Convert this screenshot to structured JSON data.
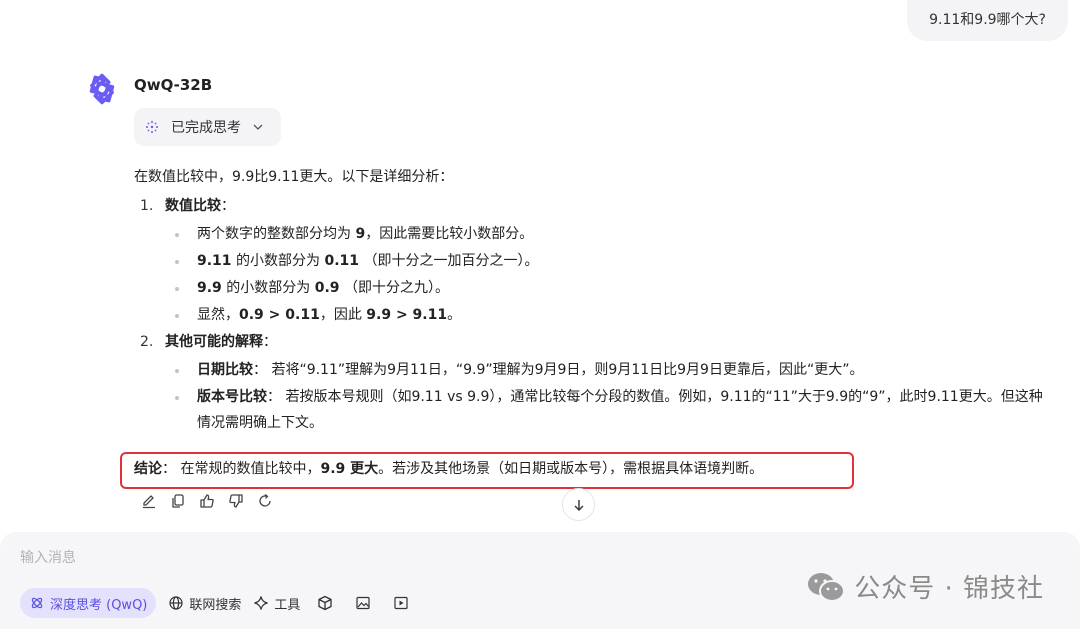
{
  "user_message": "9.11和9.9哪个大?",
  "model": {
    "name": "QwQ-32B"
  },
  "thinking": {
    "label": "已完成思考"
  },
  "answer": {
    "intro": "在数值比较中，9.9比9.11更大。以下是详细分析：",
    "sections": [
      {
        "num": "1.",
        "heading": "数值比较",
        "colon": "：",
        "bullets": [
          {
            "t1": "两个数字的整数部分均为 ",
            "b1": "9",
            "t2": "，因此需要比较小数部分。"
          },
          {
            "b1": "9.11",
            "t1": " 的小数部分为 ",
            "b2": "0.11",
            "t2": " （即十分之一加百分之一）。"
          },
          {
            "b1": "9.9",
            "t1": " 的小数部分为 ",
            "b2": "0.9",
            "t2": " （即十分之九）。"
          },
          {
            "t1": "显然，",
            "b1": "0.9 > 0.11",
            "t2": "，因此 ",
            "b2": "9.9 > 9.11",
            "t3": "。"
          }
        ]
      },
      {
        "num": "2.",
        "heading": "其他可能的解释",
        "colon": "：",
        "bullets": [
          {
            "b1": "日期比较",
            "t1": "： 若将“9.11”理解为9月11日，“9.9”理解为9月9日，则9月11日比9月9日更靠后，因此“更大”。"
          },
          {
            "b1": "版本号比较",
            "t1": "： 若按版本号规则（如9.11 vs 9.9），通常比较每个分段的数值。例如，9.11的“11”大于9.9的“9”，此时9.11更大。但这种情况需明确上下文。"
          }
        ]
      }
    ],
    "conclusion": {
      "label": "结论",
      "t1": "： 在常规的数值比较中，",
      "b1": "9.9 更大",
      "t2": "。若涉及其他场景（如日期或版本号），需根据具体语境判断。"
    }
  },
  "input": {
    "placeholder": "输入消息",
    "value": ""
  },
  "tools": {
    "deep_think": "深度思考 (QwQ)",
    "web_search": "联网搜索",
    "tools": "工具"
  },
  "watermark": "公众号 · 锦技社",
  "colors": {
    "accent": "#5b4fe0",
    "highlight_border": "#e0323a",
    "logo": "#6b5cf6"
  }
}
